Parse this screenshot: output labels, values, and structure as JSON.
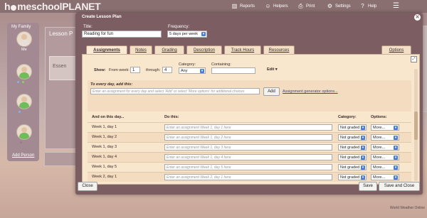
{
  "app": {
    "logo_prefix": "h",
    "logo_main": "meschool",
    "logo_brand": "PLANET"
  },
  "nav": [
    {
      "label": "Reports",
      "icon": "chart-icon"
    },
    {
      "label": "Helpers",
      "icon": "people-icon"
    },
    {
      "label": "Print",
      "icon": "printer-icon"
    },
    {
      "label": "Settings",
      "icon": "gear-icon"
    },
    {
      "label": "Help",
      "icon": "question-icon"
    }
  ],
  "family": {
    "title": "My Family",
    "members": [
      {
        "caption": "Me"
      },
      {
        "caption": ""
      },
      {
        "caption": ""
      },
      {
        "caption": ""
      }
    ],
    "add_person": "Add Person"
  },
  "background": {
    "lesson_panel_label": "Lesson P",
    "essen_text": "Essen"
  },
  "modal": {
    "title": "Create Lesson Plan",
    "title_label": "Title:",
    "title_value": "Reading for fun",
    "frequency_label": "Frequency:",
    "frequency_value": "5 days per week",
    "tabs": [
      "Assignments",
      "Notes",
      "Grading",
      "Description",
      "Track Hours",
      "Resources"
    ],
    "options_tab": "Options",
    "show_label": "Show:",
    "from_week_label": "From week:",
    "from_week_value": "1",
    "through_label": "through:",
    "through_value": "4",
    "category_label": "Category:",
    "category_value": "Any",
    "containing_label": "Containing:",
    "containing_value": "",
    "edit_label": "Edit",
    "every_day_label": "To every day, add this:",
    "every_day_placeholder": "Enter an assignment for every day and select 'Add' or select 'More options' for additional choices",
    "add_button": "Add",
    "generator_link": "Assignment generator options...",
    "columns": {
      "day": "And on this day...",
      "do": "Do this:",
      "category": "Category:",
      "options": "Options:"
    },
    "rows": [
      {
        "day": "Week 1, day 1",
        "placeholder": "Enter an assignment Week 1, day 1 here",
        "category": "Not graded",
        "options": "More..."
      },
      {
        "day": "Week 1, day 2",
        "placeholder": "Enter an assignment Week 1, day 2 here",
        "category": "Not graded",
        "options": "More..."
      },
      {
        "day": "Week 1, day 3",
        "placeholder": "Enter an assignment Week 1, day 3 here",
        "category": "Not graded",
        "options": "More..."
      },
      {
        "day": "Week 1, day 4",
        "placeholder": "Enter an assignment Week 1, day 4 here",
        "category": "Not graded",
        "options": "More..."
      },
      {
        "day": "Week 1, day 5",
        "placeholder": "Enter an assignment Week 1, day 5 here",
        "category": "Not graded",
        "options": "More..."
      },
      {
        "day": "Week 2, day 1",
        "placeholder": "Enter an assignment Week 2, day 1 here",
        "category": "Not graded",
        "options": "More..."
      }
    ],
    "close_button": "Close",
    "save_button": "Save",
    "save_close_button": "Save and Close"
  },
  "footer": {
    "weather_label": "World Weather Online"
  },
  "colors": {
    "topbar": "#8a6f70",
    "modal": "#7b5d62",
    "panel": "#f8e6cd",
    "tab": "#f2dfc6",
    "accent": "#4a7cd6"
  }
}
